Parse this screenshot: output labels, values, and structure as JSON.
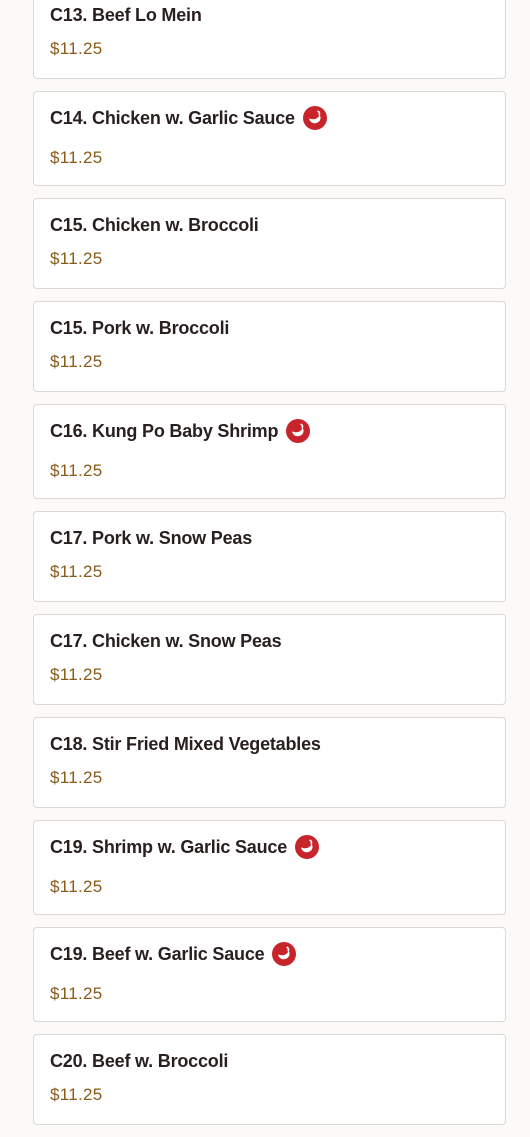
{
  "menu": {
    "items": [
      {
        "name": "C13. Beef Lo Mein",
        "price": "$11.25",
        "spicy": false
      },
      {
        "name": "C14. Chicken w. Garlic Sauce",
        "price": "$11.25",
        "spicy": true
      },
      {
        "name": "C15. Chicken w. Broccoli",
        "price": "$11.25",
        "spicy": false
      },
      {
        "name": "C15. Pork w. Broccoli",
        "price": "$11.25",
        "spicy": false
      },
      {
        "name": "C16. Kung Po Baby Shrimp",
        "price": "$11.25",
        "spicy": true
      },
      {
        "name": "C17. Pork w. Snow Peas",
        "price": "$11.25",
        "spicy": false
      },
      {
        "name": "C17. Chicken w. Snow Peas",
        "price": "$11.25",
        "spicy": false
      },
      {
        "name": "C18. Stir Fried Mixed Vegetables",
        "price": "$11.25",
        "spicy": false
      },
      {
        "name": "C19. Shrimp w. Garlic Sauce",
        "price": "$11.25",
        "spicy": true
      },
      {
        "name": "C19. Beef w. Garlic Sauce",
        "price": "$11.25",
        "spicy": true
      },
      {
        "name": "C20. Beef w. Broccoli",
        "price": "$11.25",
        "spicy": false
      }
    ]
  },
  "icons": {
    "spicy": "chili-pepper-icon"
  },
  "colors": {
    "spicy_badge": "#c8242b",
    "price": "#8a5a1a",
    "item_name": "#2a1f1f"
  }
}
